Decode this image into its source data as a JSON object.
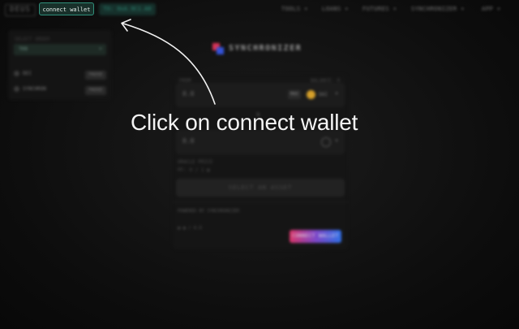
{
  "topbar": {
    "logo": "DEUS",
    "connect_button": "connect wallet",
    "address_pill": "TX: 0xA.9C1.A0",
    "nav": [
      "TOOLS ▾",
      "LOANS ▾",
      "FUTURES ▾",
      "SYNCHRONIZER ▾",
      "APP ▾"
    ]
  },
  "left_panel": {
    "label": "SELECT ORDER",
    "select_value": "TKN",
    "rows": [
      {
        "name": "DEI",
        "action": "PAUSE"
      },
      {
        "name": "SYNCHRON",
        "action": "PAUSE"
      }
    ]
  },
  "brand": {
    "name": "SYNCHRONIZER"
  },
  "swap": {
    "from_label": "FROM",
    "balance_label": "BALANCE: 0",
    "from_amount": "0.0",
    "max_label": "MAX",
    "from_token": "DAI",
    "swap_arrow": "⇅",
    "to_amount": "0.0",
    "price_label": "ORACLE PRICE",
    "price_value": "PF: 0 / 1  ◉",
    "select_asset": "SELECT AN ASSET",
    "fee_label": "POWERED BY SYNCHRONIZER",
    "fee_value": "◉ ◉  /  0.0",
    "connect_label": "CONNECT WALLET"
  },
  "annotation": {
    "text": "Click on connect wallet"
  },
  "colors": {
    "accent": "#2f8f7a",
    "brand_red": "#d83456",
    "brand_blue": "#3453d8"
  }
}
